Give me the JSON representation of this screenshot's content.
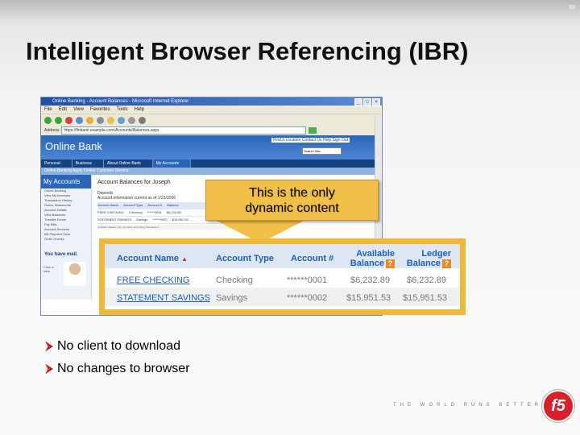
{
  "slide": {
    "number": "33",
    "title": "Intelligent Browser Referencing (IBR)"
  },
  "browser": {
    "window_title": "Online Banking - Account Balances - Microsoft Internet Explorer",
    "menu": [
      "File",
      "Edit",
      "View",
      "Favorites",
      "Tools",
      "Help"
    ],
    "address": "https://finbank.example.com/Accounts/Balances.aspx",
    "bank_name": "Online Bank",
    "top_links": "Find a Location   Contact Us   Help   Sign Out",
    "search_value": "Search Site",
    "nav_tabs": [
      "Personal",
      "Business",
      "About Online Bank",
      "My Accounts"
    ],
    "sub_nav": "Online Banking   Apply Online   Customer Service",
    "sidebar_title": "My Accounts",
    "sidebar_items": [
      "Online Banking",
      "View My Accounts",
      "Transaction History",
      "Online Statements",
      "Account Details",
      "View Balances",
      "Transfer Funds",
      "Pay Bills",
      "Account Services",
      "Bill Payment Data",
      "Order Checks"
    ],
    "sidebar_promo": "You have mail.",
    "sidebar_promo_text": "Click to view",
    "page_heading": "Account Balances for Joseph",
    "page_desc_1": "Deposits",
    "page_desc_2": "Account information current as of 1/23/2006",
    "logout": "Log out",
    "mini_headers": [
      "Account Name",
      "Account Type",
      "Account #",
      "Balance"
    ],
    "mini_rows": [
      [
        "FREE CHECKING",
        "Checking",
        "******0001",
        "$6,232.89"
      ],
      [
        "STATEMENT SAVINGS",
        "Savings",
        "******0002",
        "$15,951.53"
      ]
    ],
    "mini_note": "Available balance may not reflect all pending transactions"
  },
  "callout": {
    "line1": "This is the only",
    "line2": "dynamic content"
  },
  "zoom_table": {
    "headers": {
      "name": "Account Name",
      "type": "Account Type",
      "num": "Account #",
      "avail1": "Available",
      "avail2": "Balance",
      "ledger1": "Ledger",
      "ledger2": "Balance"
    },
    "sort_glyph": "▲",
    "help_glyph": "?",
    "rows": [
      {
        "name": "FREE CHECKING",
        "type": "Checking",
        "num": "******0001",
        "available": "$6,232.89",
        "ledger": "$6,232.89"
      },
      {
        "name": "STATEMENT SAVINGS",
        "type": "Savings",
        "num": "******0002",
        "available": "$15,951.53",
        "ledger": "$15,951.53"
      }
    ]
  },
  "bullets": [
    "No client to download",
    "No changes to browser"
  ],
  "footer": {
    "tagline": "THE WORLD RUNS BETTER WITH",
    "logo": "f5"
  },
  "colors": {
    "accent": "#d8202a",
    "callout": "#f1c048",
    "link": "#215fb3"
  }
}
